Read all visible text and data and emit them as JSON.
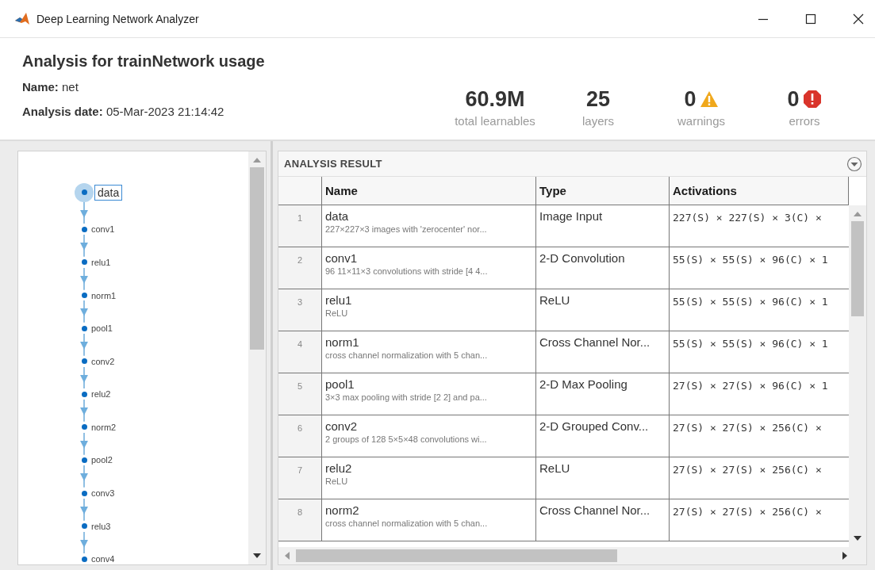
{
  "window": {
    "title": "Deep Learning Network Analyzer"
  },
  "header": {
    "title": "Analysis for trainNetwork usage",
    "name_label": "Name:",
    "name_value": "net",
    "date_label": "Analysis date:",
    "date_value": "05-Mar-2023 21:14:42"
  },
  "stats": [
    {
      "kind": "plain",
      "value": "60.9M",
      "label": "total learnables"
    },
    {
      "kind": "plain",
      "value": "25",
      "label": "layers"
    },
    {
      "kind": "warning",
      "value": "0",
      "label": "warnings"
    },
    {
      "kind": "error",
      "value": "0",
      "label": "errors"
    }
  ],
  "graph": {
    "nodes": [
      {
        "label": "data",
        "selected": true
      },
      {
        "label": "conv1",
        "selected": false
      },
      {
        "label": "relu1",
        "selected": false
      },
      {
        "label": "norm1",
        "selected": false
      },
      {
        "label": "pool1",
        "selected": false
      },
      {
        "label": "conv2",
        "selected": false
      },
      {
        "label": "relu2",
        "selected": false
      },
      {
        "label": "norm2",
        "selected": false
      },
      {
        "label": "pool2",
        "selected": false
      },
      {
        "label": "conv3",
        "selected": false
      },
      {
        "label": "relu3",
        "selected": false
      },
      {
        "label": "conv4",
        "selected": false
      }
    ]
  },
  "results": {
    "title": "ANALYSIS RESULT",
    "columns": [
      "Name",
      "Type",
      "Activations"
    ],
    "rows": [
      {
        "index": "1",
        "name": "data",
        "description": "227×227×3 images with 'zerocenter' nor...",
        "type": "Image Input",
        "activations": "227(S) × 227(S) × 3(C) ×"
      },
      {
        "index": "2",
        "name": "conv1",
        "description": "96 11×11×3 convolutions with stride [4 4...",
        "type": "2-D Convolution",
        "activations": "55(S) × 55(S) × 96(C) × 1"
      },
      {
        "index": "3",
        "name": "relu1",
        "description": "ReLU",
        "type": "ReLU",
        "activations": "55(S) × 55(S) × 96(C) × 1"
      },
      {
        "index": "4",
        "name": "norm1",
        "description": "cross channel normalization with 5 chan...",
        "type": "Cross Channel Nor...",
        "activations": "55(S) × 55(S) × 96(C) × 1"
      },
      {
        "index": "5",
        "name": "pool1",
        "description": "3×3 max pooling with stride [2 2] and pa...",
        "type": "2-D Max Pooling",
        "activations": "27(S) × 27(S) × 96(C) × 1"
      },
      {
        "index": "6",
        "name": "conv2",
        "description": "2 groups of 128 5×5×48 convolutions wi...",
        "type": "2-D Grouped Conv...",
        "activations": "27(S) × 27(S) × 256(C) ×"
      },
      {
        "index": "7",
        "name": "relu2",
        "description": "ReLU",
        "type": "ReLU",
        "activations": "27(S) × 27(S) × 256(C) ×"
      },
      {
        "index": "8",
        "name": "norm2",
        "description": "cross channel normalization with 5 chan...",
        "type": "Cross Channel Nor...",
        "activations": "27(S) × 27(S) × 256(C) ×"
      }
    ]
  }
}
